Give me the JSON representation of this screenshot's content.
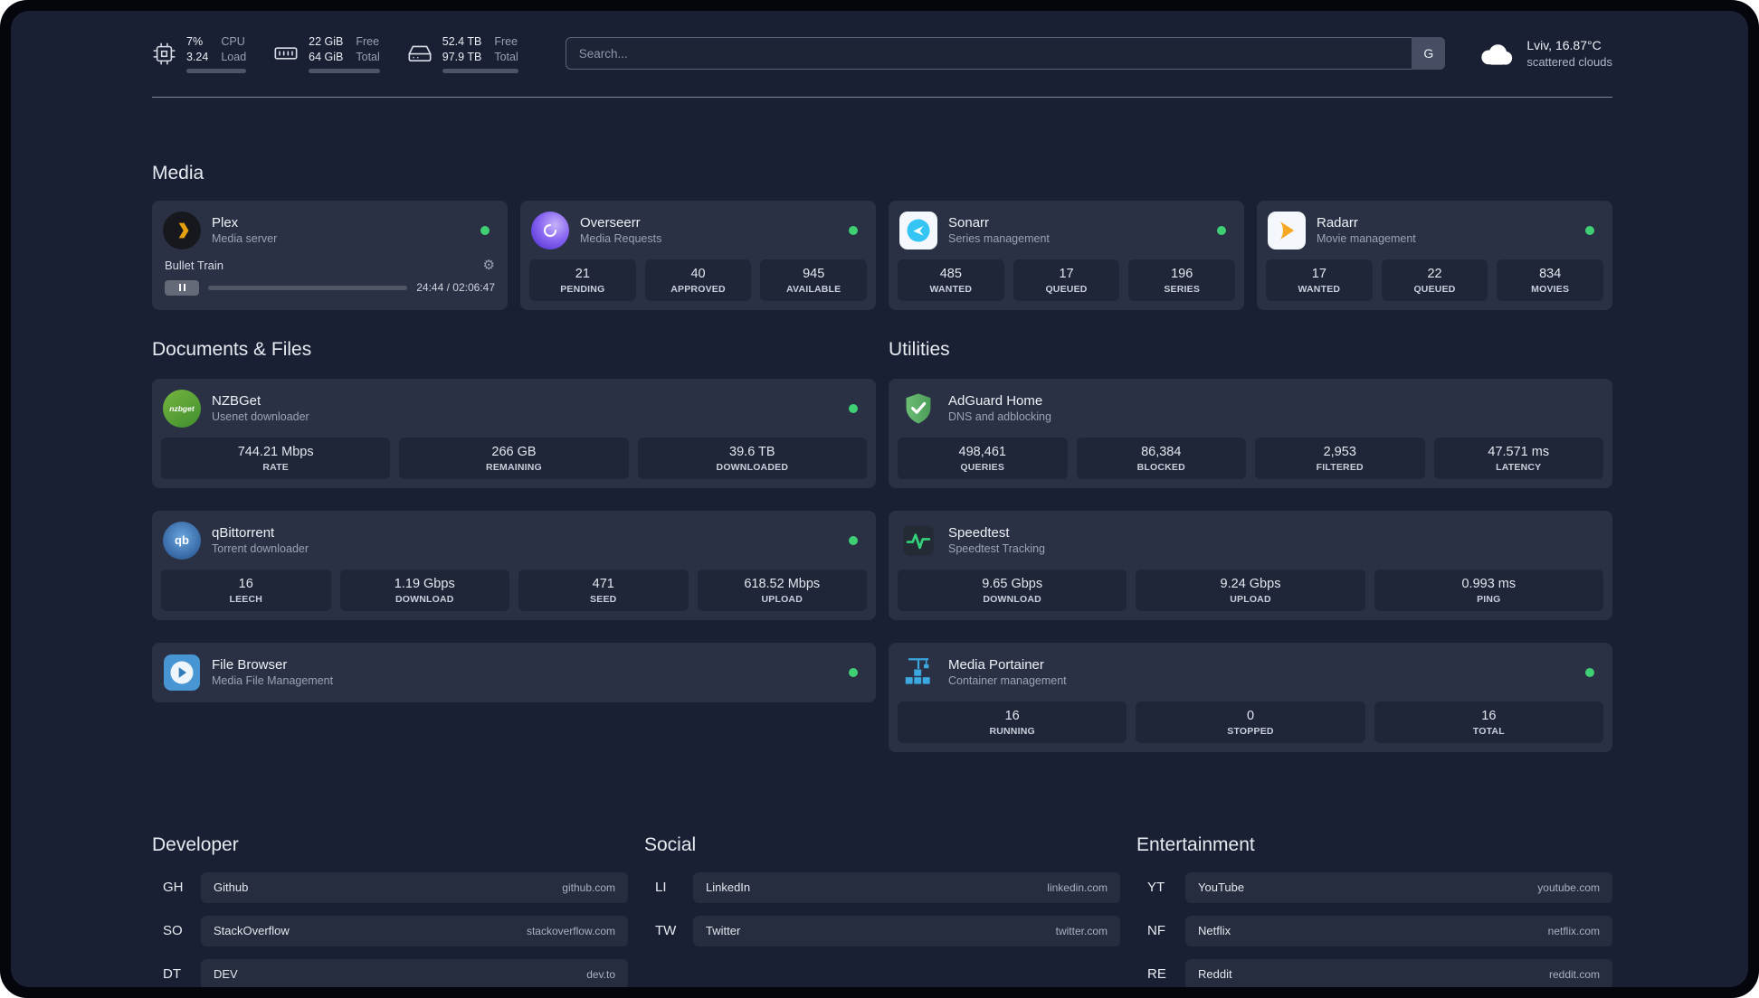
{
  "colors": {
    "status_online": "#3fd074",
    "accent_amber": "#e5a00d",
    "background": "#1a2033"
  },
  "topbar": {
    "cpu": {
      "value1": "7%",
      "label1": "CPU",
      "value2": "3.24",
      "label2": "Load",
      "progress": 38
    },
    "memory": {
      "value1": "22 GiB",
      "label1": "Free",
      "value2": "64 GiB",
      "label2": "Total",
      "progress": 34
    },
    "disk": {
      "value1": "52.4 TB",
      "label1": "Free",
      "value2": "97.9 TB",
      "label2": "Total",
      "progress": 54
    },
    "search": {
      "placeholder": "Search...",
      "button": "G"
    },
    "weather": {
      "location": "Lviv, 16.87°C",
      "condition": "scattered clouds"
    }
  },
  "media": {
    "title": "Media",
    "cards": [
      {
        "name": "Plex",
        "desc": "Media server",
        "player": {
          "track": "Bullet Train",
          "time": "24:44 / 02:06:47",
          "progress": 20
        }
      },
      {
        "name": "Overseerr",
        "desc": "Media Requests",
        "stats": [
          {
            "value": "21",
            "label": "PENDING"
          },
          {
            "value": "40",
            "label": "APPROVED"
          },
          {
            "value": "945",
            "label": "AVAILABLE"
          }
        ]
      },
      {
        "name": "Sonarr",
        "desc": "Series management",
        "stats": [
          {
            "value": "485",
            "label": "WANTED"
          },
          {
            "value": "17",
            "label": "QUEUED"
          },
          {
            "value": "196",
            "label": "SERIES"
          }
        ]
      },
      {
        "name": "Radarr",
        "desc": "Movie management",
        "stats": [
          {
            "value": "17",
            "label": "WANTED"
          },
          {
            "value": "22",
            "label": "QUEUED"
          },
          {
            "value": "834",
            "label": "MOVIES"
          }
        ]
      }
    ]
  },
  "documents": {
    "title": "Documents & Files",
    "cards": [
      {
        "name": "NZBGet",
        "desc": "Usenet downloader",
        "stats": [
          {
            "value": "744.21 Mbps",
            "label": "RATE"
          },
          {
            "value": "266 GB",
            "label": "REMAINING"
          },
          {
            "value": "39.6 TB",
            "label": "DOWNLOADED"
          }
        ]
      },
      {
        "name": "qBittorrent",
        "desc": "Torrent downloader",
        "stats": [
          {
            "value": "16",
            "label": "LEECH"
          },
          {
            "value": "1.19 Gbps",
            "label": "DOWNLOAD"
          },
          {
            "value": "471",
            "label": "SEED"
          },
          {
            "value": "618.52 Mbps",
            "label": "UPLOAD"
          }
        ]
      },
      {
        "name": "File Browser",
        "desc": "Media File Management"
      }
    ]
  },
  "utilities": {
    "title": "Utilities",
    "cards": [
      {
        "name": "AdGuard Home",
        "desc": "DNS and adblocking",
        "stats": [
          {
            "value": "498,461",
            "label": "QUERIES"
          },
          {
            "value": "86,384",
            "label": "BLOCKED"
          },
          {
            "value": "2,953",
            "label": "FILTERED"
          },
          {
            "value": "47.571 ms",
            "label": "LATENCY"
          }
        ]
      },
      {
        "name": "Speedtest",
        "desc": "Speedtest Tracking",
        "stats": [
          {
            "value": "9.65 Gbps",
            "label": "DOWNLOAD"
          },
          {
            "value": "9.24 Gbps",
            "label": "UPLOAD"
          },
          {
            "value": "0.993 ms",
            "label": "PING"
          }
        ]
      },
      {
        "name": "Media Portainer",
        "desc": "Container management",
        "stats": [
          {
            "value": "16",
            "label": "RUNNING"
          },
          {
            "value": "0",
            "label": "STOPPED"
          },
          {
            "value": "16",
            "label": "TOTAL"
          }
        ]
      }
    ]
  },
  "bookmarks": {
    "groups": [
      {
        "title": "Developer",
        "items": [
          {
            "abbr": "GH",
            "name": "Github",
            "url": "github.com"
          },
          {
            "abbr": "SO",
            "name": "StackOverflow",
            "url": "stackoverflow.com"
          },
          {
            "abbr": "DT",
            "name": "DEV",
            "url": "dev.to"
          }
        ]
      },
      {
        "title": "Social",
        "items": [
          {
            "abbr": "LI",
            "name": "LinkedIn",
            "url": "linkedin.com"
          },
          {
            "abbr": "TW",
            "name": "Twitter",
            "url": "twitter.com"
          }
        ]
      },
      {
        "title": "Entertainment",
        "items": [
          {
            "abbr": "YT",
            "name": "YouTube",
            "url": "youtube.com"
          },
          {
            "abbr": "NF",
            "name": "Netflix",
            "url": "netflix.com"
          },
          {
            "abbr": "RE",
            "name": "Reddit",
            "url": "reddit.com"
          }
        ]
      }
    ]
  },
  "icons": {
    "nzbget_text": "nzbget",
    "qbittorrent_text": "qb"
  }
}
